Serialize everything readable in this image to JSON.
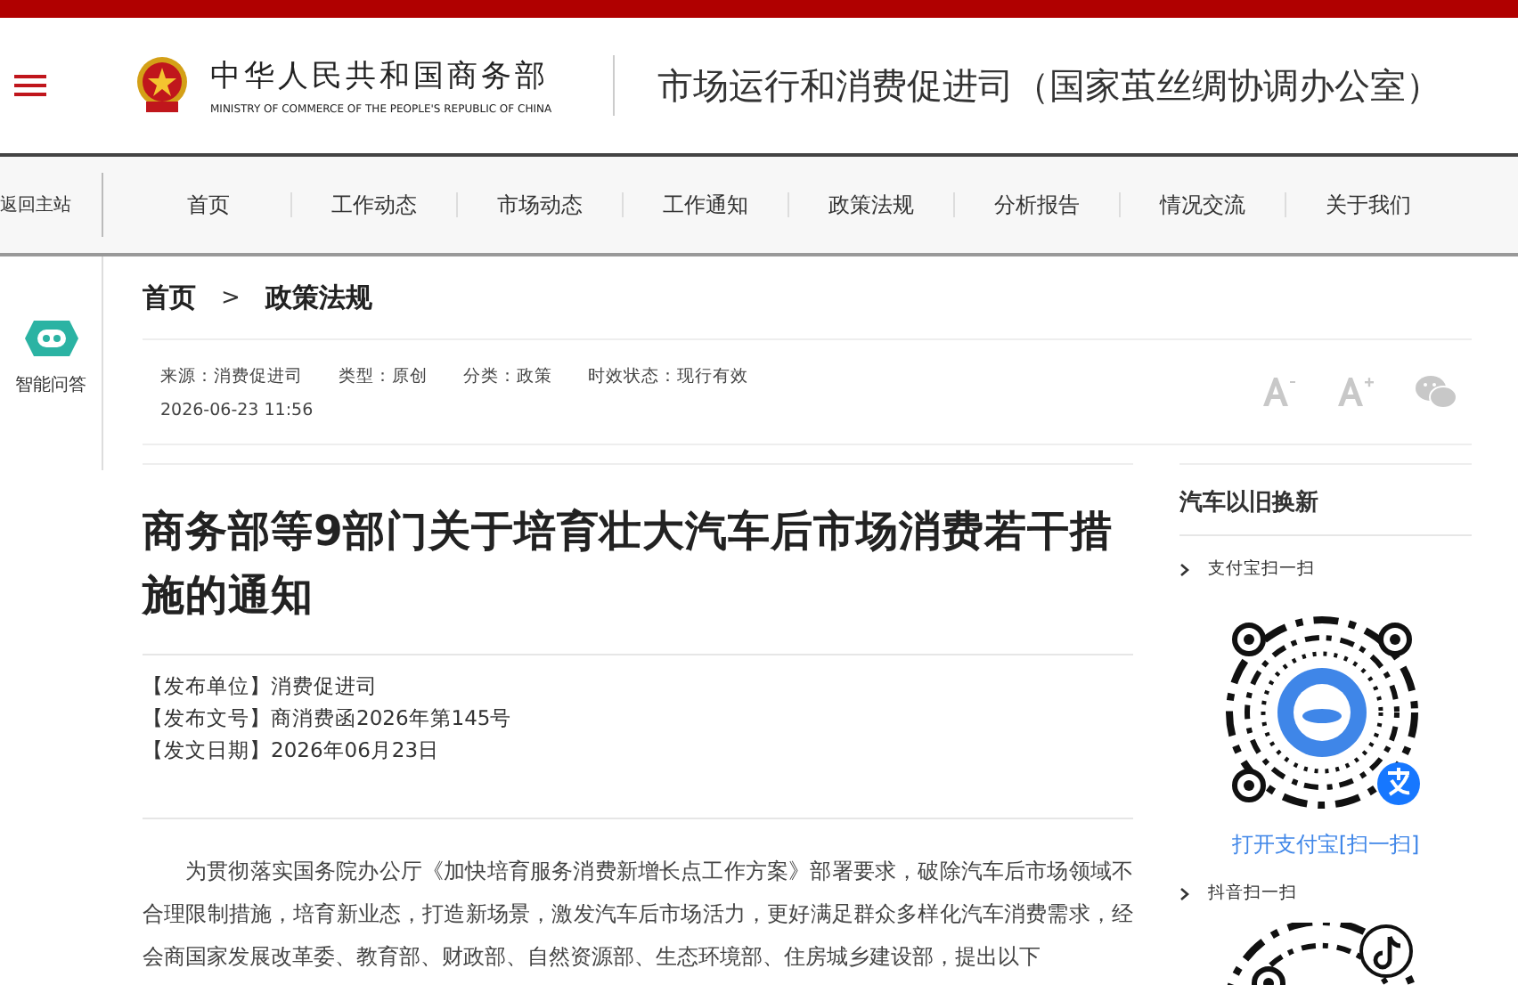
{
  "header": {
    "ministry_name": "中华人民共和国商务部",
    "ministry_name_en": "MINISTRY OF COMMERCE OF THE PEOPLE'S REPUBLIC OF CHINA",
    "department_title": "市场运行和消费促进司（国家茧丝绸协调办公室）"
  },
  "nav": {
    "back_link": "返回主站",
    "items": [
      {
        "label": "首页",
        "selected": false
      },
      {
        "label": "工作动态",
        "selected": false
      },
      {
        "label": "市场动态",
        "selected": false
      },
      {
        "label": "工作通知",
        "selected": false
      },
      {
        "label": "政策法规",
        "selected": false
      },
      {
        "label": "分析报告",
        "selected": false
      },
      {
        "label": "情况交流",
        "selected": false
      },
      {
        "label": "关于我们",
        "selected": false
      }
    ]
  },
  "side_tool": {
    "label": "智能问答"
  },
  "breadcrumb": {
    "items": [
      "首页",
      "政策法规"
    ],
    "separator": ">"
  },
  "meta": {
    "fields": [
      "来源：消费促进司",
      "类型：原创",
      "分类：政策",
      "时效状态：现行有效"
    ],
    "date": "2026-06-23 11:56"
  },
  "article": {
    "title": "商务部等9部门关于培育壮大汽车后市场消费若干措施的通知",
    "info": [
      {
        "label": "【发布单位】",
        "value": "消费促进司"
      },
      {
        "label": "【发布文号】",
        "value": "商消费函2026年第145号"
      },
      {
        "label": "【发文日期】",
        "value": "2026年06月23日"
      }
    ],
    "body": "为贯彻落实国务院办公厅《加快培育服务消费新增长点工作方案》部署要求，破除汽车后市场领域不合理限制措施，培育新业态，打造新场景，激发汽车后市场活力，更好满足群众多样化汽车消费需求，经会商国家发展改革委、教育部、财政部、自然资源部、生态环境部、住房城乡建设部，提出以下"
  },
  "sidebar": {
    "title": "汽车以旧换新",
    "sections": [
      {
        "kind": "alipay",
        "label": "支付宝扫一扫",
        "caption": "打开支付宝[扫一扫]"
      },
      {
        "kind": "douyin",
        "label": "抖音扫一扫"
      }
    ]
  }
}
